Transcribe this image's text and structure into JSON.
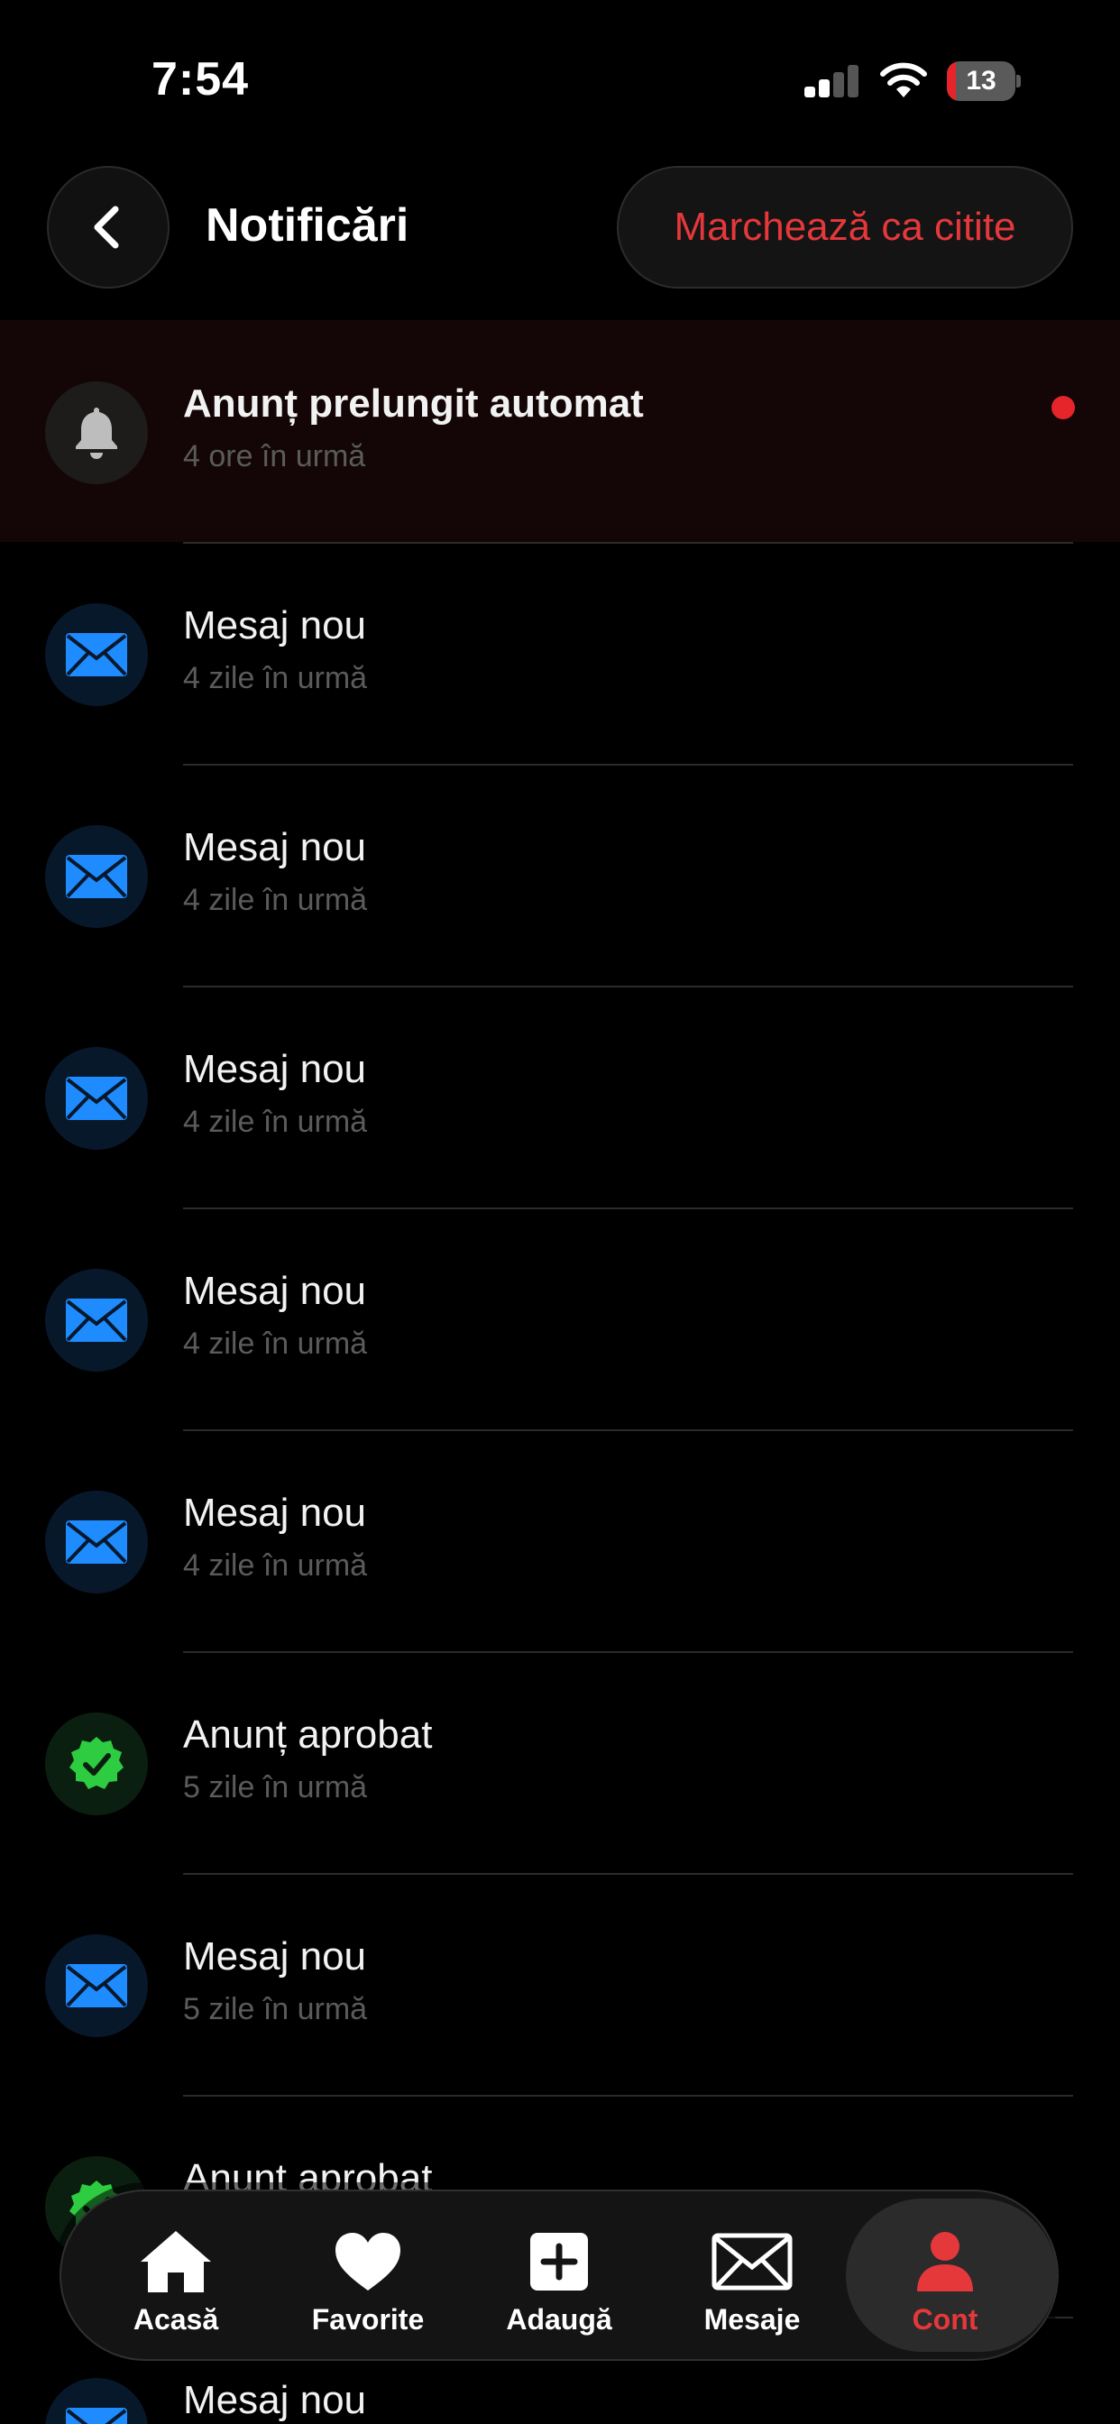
{
  "status_bar": {
    "time": "7:54",
    "battery_level": "13",
    "battery_fraction": 0.13,
    "icons": [
      "cellular-signal-icon",
      "wifi-icon",
      "battery-icon"
    ]
  },
  "header": {
    "title": "Notificări",
    "mark_read_label": "Marchează ca citite",
    "back_icon": "chevron-left-icon"
  },
  "colors": {
    "accent": "#e5383b",
    "mail_blue": "#1e8bff",
    "check_green": "#2ecc40",
    "unread_background": "#140606"
  },
  "notifications": [
    {
      "type": "bell",
      "icon": "bell-icon",
      "title": "Anunț prelungit automat",
      "time": "4 ore în urmă",
      "unread": true
    },
    {
      "type": "mail",
      "icon": "envelope-icon",
      "title": "Mesaj nou",
      "time": "4 zile în urmă",
      "unread": false
    },
    {
      "type": "mail",
      "icon": "envelope-icon",
      "title": "Mesaj nou",
      "time": "4 zile în urmă",
      "unread": false
    },
    {
      "type": "mail",
      "icon": "envelope-icon",
      "title": "Mesaj nou",
      "time": "4 zile în urmă",
      "unread": false
    },
    {
      "type": "mail",
      "icon": "envelope-icon",
      "title": "Mesaj nou",
      "time": "4 zile în urmă",
      "unread": false
    },
    {
      "type": "mail",
      "icon": "envelope-icon",
      "title": "Mesaj nou",
      "time": "4 zile în urmă",
      "unread": false
    },
    {
      "type": "check",
      "icon": "verified-badge-icon",
      "title": "Anunț aprobat",
      "time": "5 zile în urmă",
      "unread": false
    },
    {
      "type": "mail",
      "icon": "envelope-icon",
      "title": "Mesaj nou",
      "time": "5 zile în urmă",
      "unread": false
    },
    {
      "type": "check",
      "icon": "verified-badge-icon",
      "title": "Anunț aprobat",
      "time": "",
      "unread": false
    },
    {
      "type": "mail",
      "icon": "envelope-icon",
      "title": "Mesaj nou",
      "time": "",
      "unread": false
    }
  ],
  "tabbar": {
    "active": "cont",
    "tabs": [
      {
        "key": "acasa",
        "label": "Acasă",
        "icon": "home-icon"
      },
      {
        "key": "favorite",
        "label": "Favorite",
        "icon": "heart-icon"
      },
      {
        "key": "adauga",
        "label": "Adaugă",
        "icon": "plus-square-icon"
      },
      {
        "key": "mesaje",
        "label": "Mesaje",
        "icon": "envelope-icon"
      },
      {
        "key": "cont",
        "label": "Cont",
        "icon": "person-icon"
      }
    ]
  }
}
